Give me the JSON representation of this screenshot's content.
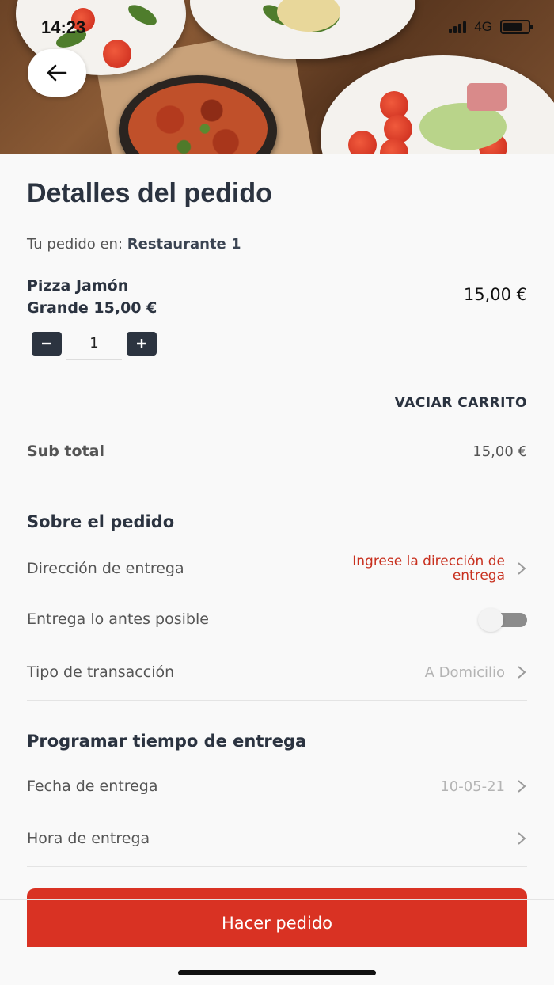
{
  "status_bar": {
    "time": "14:23",
    "network": "4G"
  },
  "header": {
    "back_icon": "arrow-left-icon"
  },
  "page": {
    "title": "Detalles del pedido",
    "restaurant_prefix": "Tu pedido en:",
    "restaurant_name": "Restaurante 1"
  },
  "cart": {
    "item_name": "Pizza Jamón",
    "item_variant": "Grande 15,00 €",
    "item_price": "15,00 €",
    "quantity": "1",
    "empty_cart_label": "VACIAR CARRITO"
  },
  "summary": {
    "subtotal_label": "Sub total",
    "subtotal_value": "15,00 €"
  },
  "order_info": {
    "section_title": "Sobre el pedido",
    "address_label": "Dirección de entrega",
    "address_value_line1": "Ingrese la dirección de",
    "address_value_line2": "entrega",
    "asap_label": "Entrega lo antes posible",
    "asap_enabled": false,
    "transaction_label": "Tipo de transacción",
    "transaction_value": "A Domicilio"
  },
  "schedule": {
    "section_title": "Programar tiempo de entrega",
    "date_label": "Fecha de entrega",
    "date_value": "10-05-21",
    "time_label": "Hora de entrega",
    "time_value": ""
  },
  "footer": {
    "order_button_label": "Hacer pedido"
  },
  "colors": {
    "accent_red": "#d93223",
    "dark_text": "#2b3340"
  }
}
